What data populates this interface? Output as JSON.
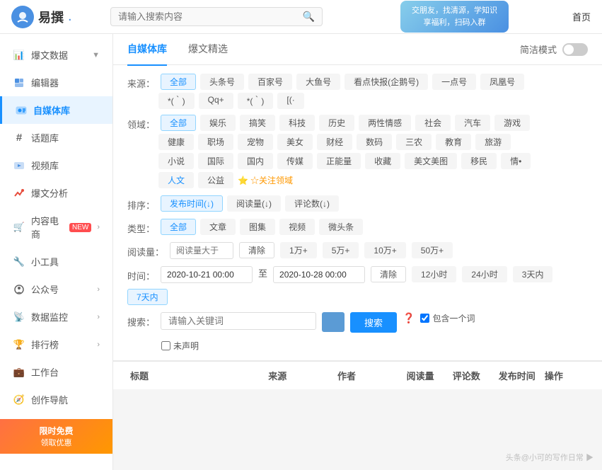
{
  "header": {
    "logo_text": "易撰",
    "logo_dot": ".",
    "search_placeholder": "请输入搜索内容",
    "banner_line1": "交朋友，找清源，学知识",
    "banner_line2": "享福利，扫码入群",
    "nav_home": "首页"
  },
  "sidebar": {
    "items": [
      {
        "id": "baowendata",
        "label": "爆文数据",
        "icon": "📊",
        "has_arrow": true,
        "active": false
      },
      {
        "id": "bianjiqui",
        "label": "编辑器",
        "icon": "✏️",
        "has_arrow": false,
        "active": false
      },
      {
        "id": "zimeiti",
        "label": "自媒体库",
        "icon": "🎵",
        "has_arrow": false,
        "active": true
      },
      {
        "id": "huatiku",
        "label": "话题库",
        "icon": "#",
        "has_arrow": false,
        "active": false
      },
      {
        "id": "shipinku",
        "label": "视频库",
        "icon": "▶️",
        "has_arrow": false,
        "active": false
      },
      {
        "id": "baowenfenxi",
        "label": "爆文分析",
        "icon": "📈",
        "has_arrow": false,
        "active": false
      },
      {
        "id": "neirong",
        "label": "内容电商",
        "icon": "🛒",
        "badge": "NEW",
        "has_arrow": true,
        "active": false
      },
      {
        "id": "xiaogongju",
        "label": "小工具",
        "icon": "",
        "has_arrow": false,
        "active": false
      },
      {
        "id": "gongzhonghao",
        "label": "公众号",
        "icon": "",
        "has_arrow": true,
        "active": false
      },
      {
        "id": "shujujiankong",
        "label": "数据监控",
        "icon": "",
        "has_arrow": true,
        "active": false
      },
      {
        "id": "paihangbang",
        "label": "排行榜",
        "icon": "",
        "has_arrow": true,
        "active": false
      },
      {
        "id": "gongtaozi",
        "label": "工作台",
        "icon": "",
        "has_arrow": false,
        "active": false
      },
      {
        "id": "chuangzuodaohang",
        "label": "创作导航",
        "icon": "",
        "has_arrow": false,
        "active": false
      }
    ],
    "promo_text": "限时免费",
    "promo_sub": "领取优惠"
  },
  "tabs": {
    "items": [
      {
        "id": "zimeiti-tab",
        "label": "自媒体库",
        "active": true
      },
      {
        "id": "baowenjingxuan-tab",
        "label": "爆文精选",
        "active": false
      },
      {
        "id": "jianjiemoshi-tab",
        "label": "简洁模式",
        "active": false
      }
    ],
    "toggle_label": "简洁模式"
  },
  "filters": {
    "source_label": "来源：",
    "source_options": [
      {
        "label": "全部",
        "active": true
      },
      {
        "label": "头条号",
        "active": false
      },
      {
        "label": "百家号",
        "active": false
      },
      {
        "label": "大鱼号",
        "active": false
      },
      {
        "label": "看点快报(企鹅号)",
        "active": false
      },
      {
        "label": "一点号",
        "active": false
      },
      {
        "label": "凤凰号",
        "active": false
      },
      {
        "label": "*(｀)",
        "active": false
      },
      {
        "label": "Qq+",
        "active": false
      },
      {
        "label": "*(｀)",
        "active": false
      },
      {
        "label": "[(·",
        "active": false
      }
    ],
    "domain_label": "领域：",
    "domain_options": [
      {
        "label": "全部",
        "active": true
      },
      {
        "label": "娱乐",
        "active": false
      },
      {
        "label": "搞笑",
        "active": false
      },
      {
        "label": "科技",
        "active": false
      },
      {
        "label": "历史",
        "active": false
      },
      {
        "label": "两性情感",
        "active": false
      },
      {
        "label": "社会",
        "active": false
      },
      {
        "label": "汽车",
        "active": false
      },
      {
        "label": "游戏",
        "active": false
      },
      {
        "label": "健康",
        "active": false
      },
      {
        "label": "职场",
        "active": false
      },
      {
        "label": "宠物",
        "active": false
      },
      {
        "label": "美女",
        "active": false
      },
      {
        "label": "财经",
        "active": false
      },
      {
        "label": "数码",
        "active": false
      },
      {
        "label": "三农",
        "active": false
      },
      {
        "label": "教育",
        "active": false
      },
      {
        "label": "旅游",
        "active": false
      },
      {
        "label": "小说",
        "active": false
      },
      {
        "label": "国际",
        "active": false
      },
      {
        "label": "国内",
        "active": false
      },
      {
        "label": "传媒",
        "active": false
      },
      {
        "label": "正能量",
        "active": false
      },
      {
        "label": "收藏",
        "active": false
      },
      {
        "label": "美文美图",
        "active": false
      },
      {
        "label": "移民",
        "active": false
      },
      {
        "label": "情•",
        "active": false
      },
      {
        "label": "人文",
        "active": false
      },
      {
        "label": "公益",
        "active": false
      }
    ],
    "attent_label": "☆关注领域",
    "sort_label": "排序：",
    "sort_options": [
      {
        "label": "发布时间(↓)",
        "active": true
      },
      {
        "label": "阅读量(↓)",
        "active": false
      },
      {
        "label": "评论数(↓)",
        "active": false
      }
    ],
    "type_label": "类型：",
    "type_options": [
      {
        "label": "全部",
        "active": true
      },
      {
        "label": "文章",
        "active": false
      },
      {
        "label": "图集",
        "active": false
      },
      {
        "label": "视频",
        "active": false
      },
      {
        "label": "微头条",
        "active": false
      }
    ],
    "read_label": "阅读量：",
    "read_placeholder": "阅读量大于",
    "read_clear": "清除",
    "read_options": [
      "1万+",
      "5万+",
      "10万+",
      "50万+"
    ],
    "time_label": "时间：",
    "time_start": "2020-10-21 00:00",
    "time_to": "至",
    "time_end": "2020-10-28 00:00",
    "time_clear": "清除",
    "time_options": [
      "12小时",
      "24小时",
      "3天内",
      "7天内"
    ],
    "time_active": "7天内",
    "search_label": "搜索：",
    "search_placeholder": "请输入关键词",
    "search_btn": "搜索",
    "include_one": "包含一个词",
    "declare_label": "未声明"
  },
  "table": {
    "columns": [
      "标题",
      "来源",
      "作者",
      "阅读量",
      "评论数",
      "发布时间",
      "操作"
    ]
  },
  "watermark": "头条@小可的写作日常 ▶"
}
